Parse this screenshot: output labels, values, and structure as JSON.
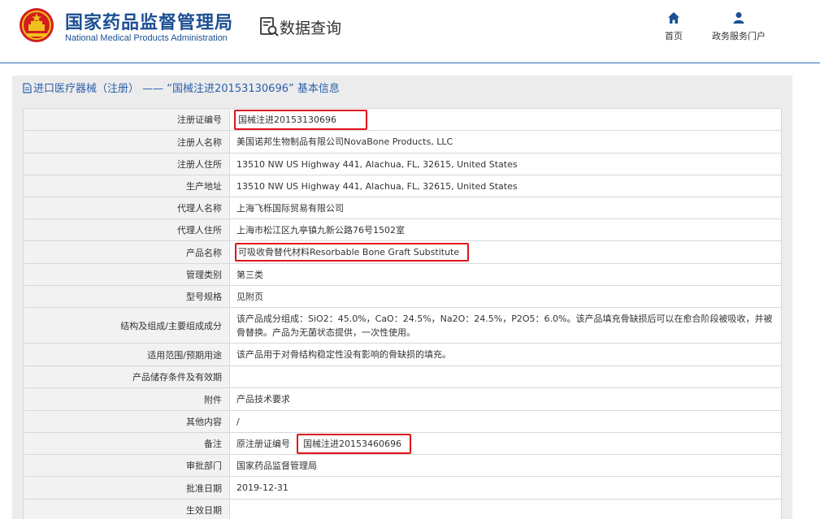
{
  "header": {
    "logo_cn": "国家药品监督管理局",
    "logo_en": "National Medical Products Administration",
    "query_title": "数据查询",
    "nav": [
      {
        "label": "首页",
        "icon": "home-icon"
      },
      {
        "label": "政务服务门户",
        "icon": "user-icon"
      }
    ]
  },
  "panel": {
    "title": "进口医疗器械（注册） —— “国械注进20153130696” 基本信息"
  },
  "rows": [
    {
      "label": "注册证编号",
      "value": "国械注进20153130696"
    },
    {
      "label": "注册人名称",
      "value": "美国诺邦生物制品有限公司NovaBone Products, LLC"
    },
    {
      "label": "注册人住所",
      "value": "13510 NW US Highway 441, Alachua, FL, 32615, United States"
    },
    {
      "label": "生产地址",
      "value": "13510 NW US Highway 441, Alachua, FL, 32615, United States"
    },
    {
      "label": "代理人名称",
      "value": "上海飞栎国际贸易有限公司"
    },
    {
      "label": "代理人住所",
      "value": "上海市松江区九亭镇九新公路76号1502室"
    },
    {
      "label": "产品名称",
      "value": "可吸收骨替代材料Resorbable Bone Graft Substitute"
    },
    {
      "label": "管理类别",
      "value": "第三类"
    },
    {
      "label": "型号规格",
      "value": "见附页"
    },
    {
      "label": "结构及组成/主要组成成分",
      "value": "该产品成分组成：SiO2：45.0%，CaO：24.5%，Na2O：24.5%，P2O5：6.0%。该产品填充骨缺损后可以在愈合阶段被吸收，并被骨替换。产品为无菌状态提供，一次性使用。"
    },
    {
      "label": "适用范围/预期用途",
      "value": "该产品用于对骨结构稳定性没有影响的骨缺损的填充。"
    },
    {
      "label": "产品储存条件及有效期",
      "value": ""
    },
    {
      "label": "附件",
      "value": "产品技术要求"
    },
    {
      "label": "其他内容",
      "value": "/"
    },
    {
      "label": "备注",
      "value": "原注册证编号",
      "extra": "国械注进20153460696"
    },
    {
      "label": "审批部门",
      "value": "国家药品监督管理局"
    },
    {
      "label": "批准日期",
      "value": "2019-12-31"
    },
    {
      "label": "生效日期",
      "value": ""
    }
  ],
  "colors": {
    "brand_blue": "#1c4f93",
    "link_blue": "#2a5faa",
    "highlight_red": "#e0141a"
  }
}
